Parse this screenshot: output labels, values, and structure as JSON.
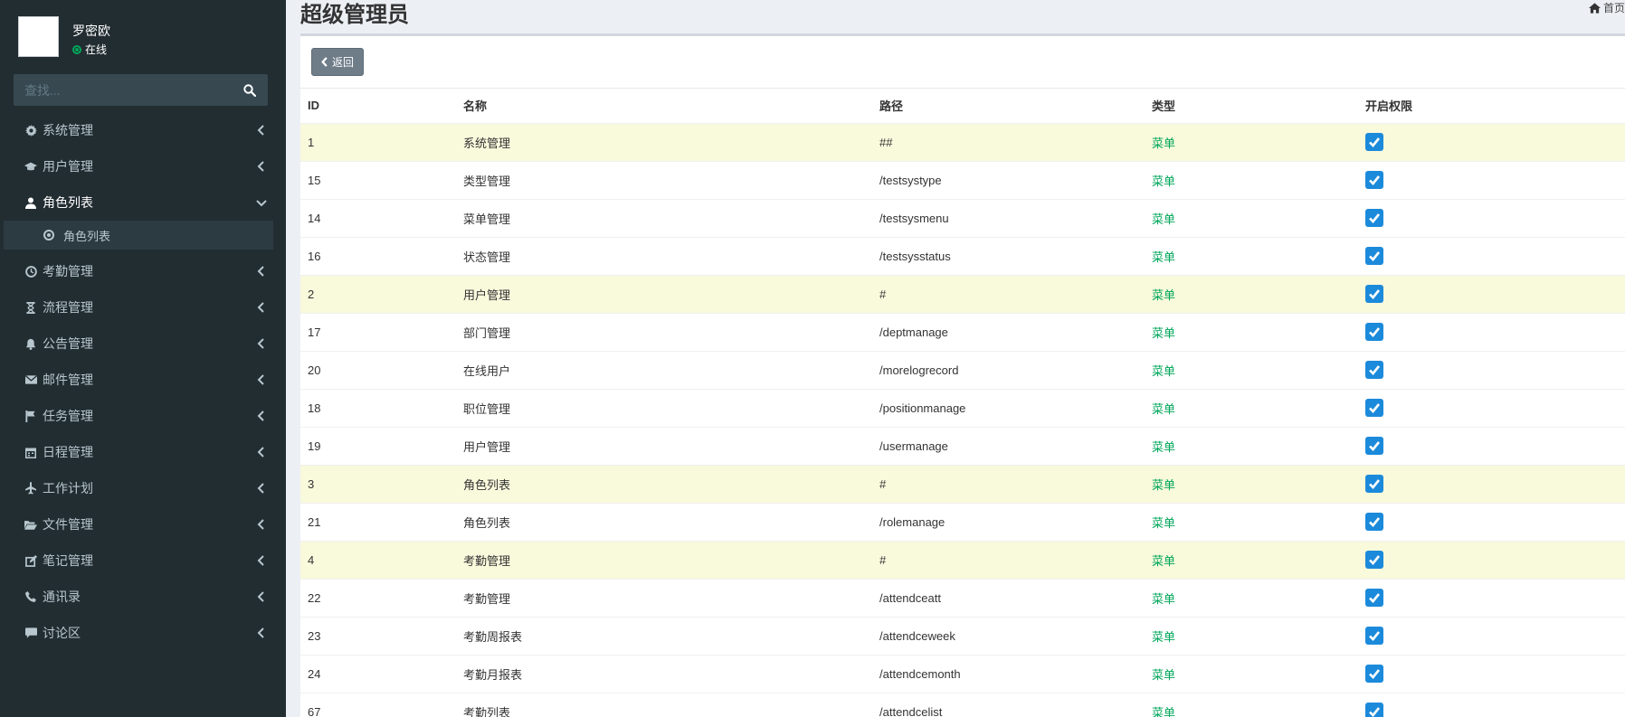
{
  "user": {
    "name": "罗密欧",
    "status": "在线"
  },
  "search": {
    "placeholder": "查找..."
  },
  "menu": {
    "items": [
      {
        "label": "系统管理",
        "icon": "gear-icon"
      },
      {
        "label": "用户管理",
        "icon": "graduation-cap-icon"
      },
      {
        "label": "角色列表",
        "icon": "user-icon",
        "open": true,
        "sub": "角色列表"
      },
      {
        "label": "考勤管理",
        "icon": "clock-icon"
      },
      {
        "label": "流程管理",
        "icon": "hourglass-icon"
      },
      {
        "label": "公告管理",
        "icon": "bell-icon"
      },
      {
        "label": "邮件管理",
        "icon": "envelope-icon"
      },
      {
        "label": "任务管理",
        "icon": "flag-icon"
      },
      {
        "label": "日程管理",
        "icon": "calendar-icon"
      },
      {
        "label": "工作计划",
        "icon": "plane-icon"
      },
      {
        "label": "文件管理",
        "icon": "folder-open-icon"
      },
      {
        "label": "笔记管理",
        "icon": "edit-icon"
      },
      {
        "label": "通讯录",
        "icon": "phone-icon"
      },
      {
        "label": "讨论区",
        "icon": "comment-icon"
      }
    ]
  },
  "page": {
    "title": "超级管理员",
    "breadcrumb": "首页"
  },
  "toolbar": {
    "back_label": "返回"
  },
  "table": {
    "headers": {
      "id": "ID",
      "name": "名称",
      "path": "路径",
      "type": "类型",
      "perm": "开启权限"
    },
    "rows": [
      {
        "id": "1",
        "name": "系统管理",
        "path": "##",
        "type": "菜单",
        "checked": true,
        "highlight": true
      },
      {
        "id": "15",
        "name": "类型管理",
        "path": "/testsystype",
        "type": "菜单",
        "checked": true,
        "highlight": false
      },
      {
        "id": "14",
        "name": "菜单管理",
        "path": "/testsysmenu",
        "type": "菜单",
        "checked": true,
        "highlight": false
      },
      {
        "id": "16",
        "name": "状态管理",
        "path": "/testsysstatus",
        "type": "菜单",
        "checked": true,
        "highlight": false
      },
      {
        "id": "2",
        "name": "用户管理",
        "path": "#",
        "type": "菜单",
        "checked": true,
        "highlight": true
      },
      {
        "id": "17",
        "name": "部门管理",
        "path": "/deptmanage",
        "type": "菜单",
        "checked": true,
        "highlight": false
      },
      {
        "id": "20",
        "name": "在线用户",
        "path": "/morelogrecord",
        "type": "菜单",
        "checked": true,
        "highlight": false
      },
      {
        "id": "18",
        "name": "职位管理",
        "path": "/positionmanage",
        "type": "菜单",
        "checked": true,
        "highlight": false
      },
      {
        "id": "19",
        "name": "用户管理",
        "path": "/usermanage",
        "type": "菜单",
        "checked": true,
        "highlight": false
      },
      {
        "id": "3",
        "name": "角色列表",
        "path": "#",
        "type": "菜单",
        "checked": true,
        "highlight": true
      },
      {
        "id": "21",
        "name": "角色列表",
        "path": "/rolemanage",
        "type": "菜单",
        "checked": true,
        "highlight": false
      },
      {
        "id": "4",
        "name": "考勤管理",
        "path": "#",
        "type": "菜单",
        "checked": true,
        "highlight": true
      },
      {
        "id": "22",
        "name": "考勤管理",
        "path": "/attendceatt",
        "type": "菜单",
        "checked": true,
        "highlight": false
      },
      {
        "id": "23",
        "name": "考勤周报表",
        "path": "/attendceweek",
        "type": "菜单",
        "checked": true,
        "highlight": false
      },
      {
        "id": "24",
        "name": "考勤月报表",
        "path": "/attendcemonth",
        "type": "菜单",
        "checked": true,
        "highlight": false
      },
      {
        "id": "67",
        "name": "考勤列表",
        "path": "/attendcelist",
        "type": "菜单",
        "checked": true,
        "highlight": false
      }
    ]
  },
  "colors": {
    "sidebar": "#222d32",
    "accent_green": "#00a65a",
    "checkbox": "#1c8adb",
    "highlight_row": "#f9f9dc"
  }
}
